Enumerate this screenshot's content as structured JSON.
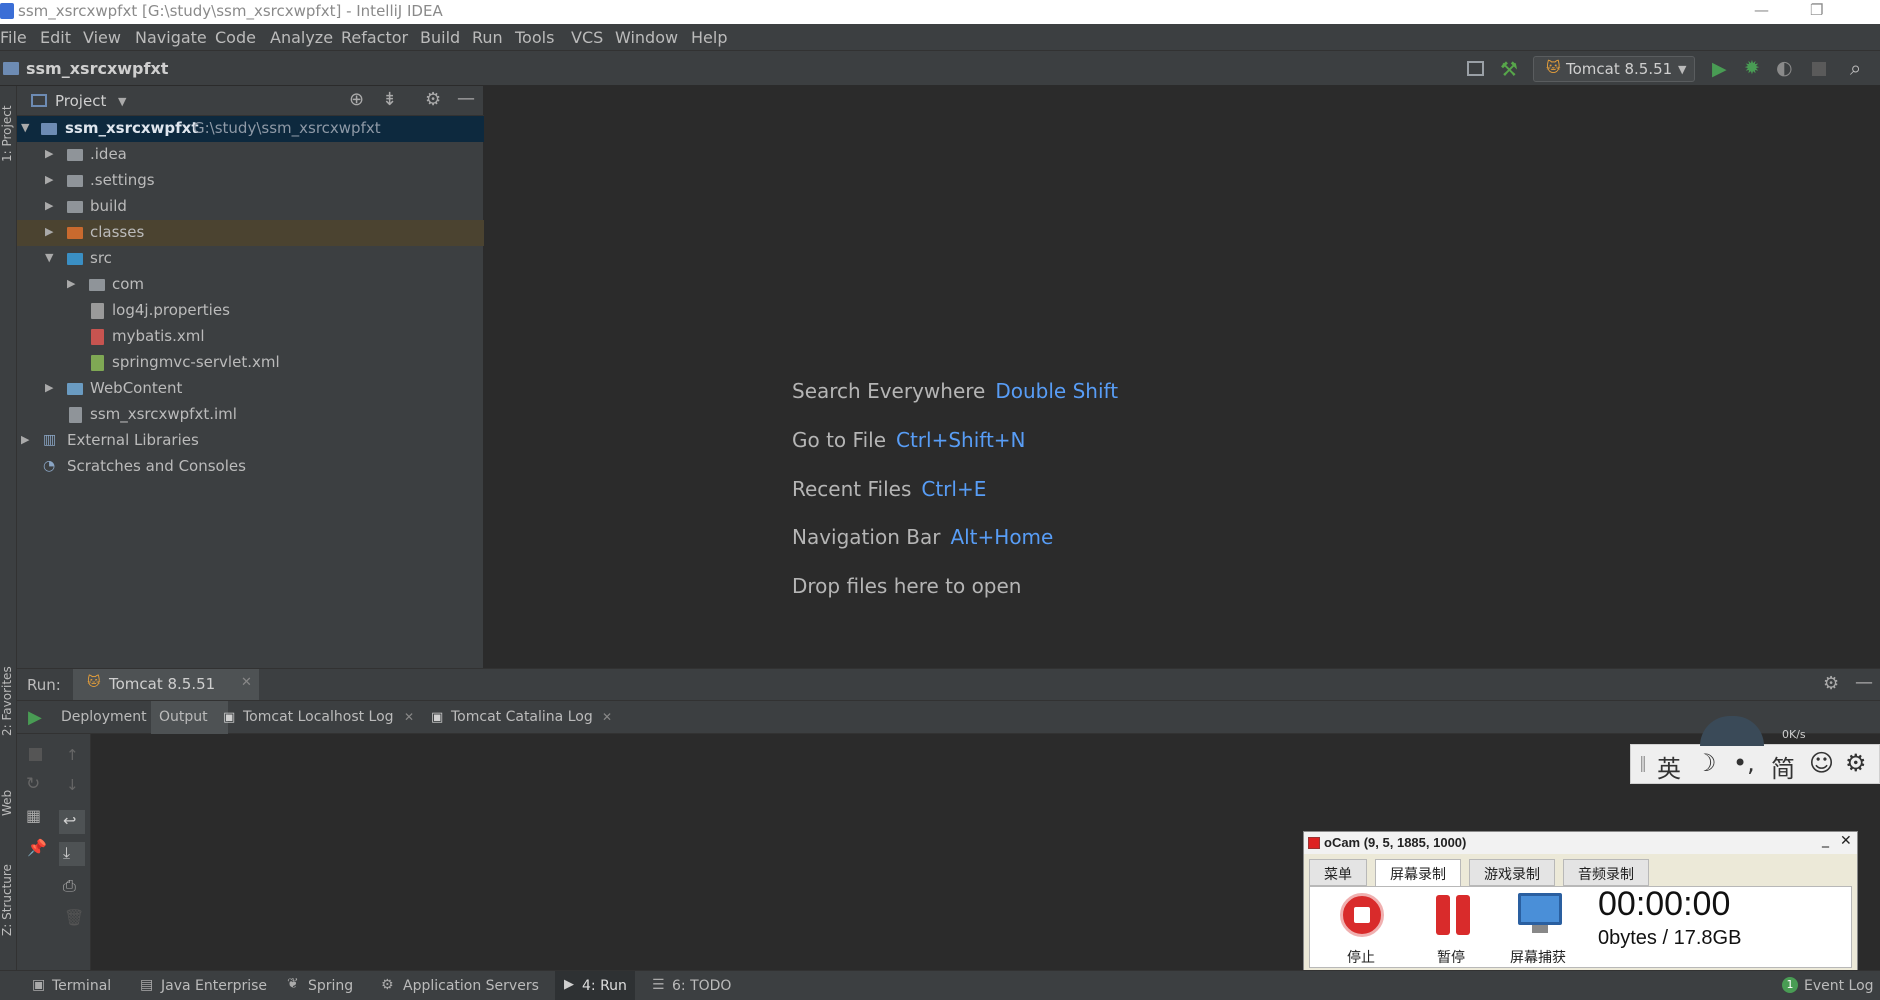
{
  "window": {
    "title": "ssm_xsrcxwpfxt [G:\\study\\ssm_xsrcxwpfxt] - IntelliJ IDEA",
    "controls": [
      "—",
      "❐",
      "✕"
    ]
  },
  "menu": [
    "File",
    "Edit",
    "View",
    "Navigate",
    "Code",
    "Analyze",
    "Refactor",
    "Build",
    "Run",
    "Tools",
    "VCS",
    "Window",
    "Help"
  ],
  "navbar": {
    "breadcrumb": "ssm_xsrcxwpfxt",
    "run_config": "Tomcat 8.5.51"
  },
  "left_strip": {
    "project": "1: Project",
    "favorites": "2: Favorites",
    "web": "Web",
    "structure": "Z: Structure"
  },
  "project_panel": {
    "title": "Project",
    "tree": [
      {
        "label": "ssm_xsrcxwpfxt",
        "path": "G:\\study\\ssm_xsrcxwpfxt"
      },
      {
        "label": ".idea"
      },
      {
        "label": ".settings"
      },
      {
        "label": "build"
      },
      {
        "label": "classes"
      },
      {
        "label": "src"
      },
      {
        "label": "com"
      },
      {
        "label": "log4j.properties"
      },
      {
        "label": "mybatis.xml"
      },
      {
        "label": "springmvc-servlet.xml"
      },
      {
        "label": "WebContent"
      },
      {
        "label": "ssm_xsrcxwpfxt.iml"
      },
      {
        "label": "External Libraries"
      },
      {
        "label": "Scratches and Consoles"
      }
    ]
  },
  "editor": {
    "hints": [
      {
        "label": "Search Everywhere",
        "key": "Double Shift"
      },
      {
        "label": "Go to File",
        "key": "Ctrl+Shift+N"
      },
      {
        "label": "Recent Files",
        "key": "Ctrl+E"
      },
      {
        "label": "Navigation Bar",
        "key": "Alt+Home"
      },
      {
        "label": "Drop files here to open",
        "key": ""
      }
    ]
  },
  "run_panel": {
    "label": "Run:",
    "config_tab": "Tomcat 8.5.51",
    "tabs": [
      "Deployment",
      "Output",
      "Tomcat Localhost Log",
      "Tomcat Catalina Log"
    ]
  },
  "status_bar": {
    "items": [
      "Terminal",
      "Java Enterprise",
      "Spring",
      "Application Servers",
      "4: Run",
      "6: TODO"
    ],
    "event_log": "Event Log",
    "event_count": "1"
  },
  "ime": {
    "chars": [
      "英",
      "☽",
      "•,",
      "简",
      "☺",
      "⚙"
    ],
    "speed": "0K/s"
  },
  "ocam": {
    "title": "oCam (9, 5, 1885, 1000)",
    "tabs": [
      "菜单",
      "屏幕录制",
      "游戏录制",
      "音频录制"
    ],
    "stop": "停止",
    "pause": "暂停",
    "capture": "屏幕捕获",
    "timer": "00:00:00",
    "size": "0bytes / 17.8GB"
  },
  "colors": {
    "accent": "#589df6",
    "run_green": "#499c54",
    "folder_orange": "#c96a2e",
    "folder_blue": "#3a8fc4",
    "stop_red": "#d92b2b"
  }
}
